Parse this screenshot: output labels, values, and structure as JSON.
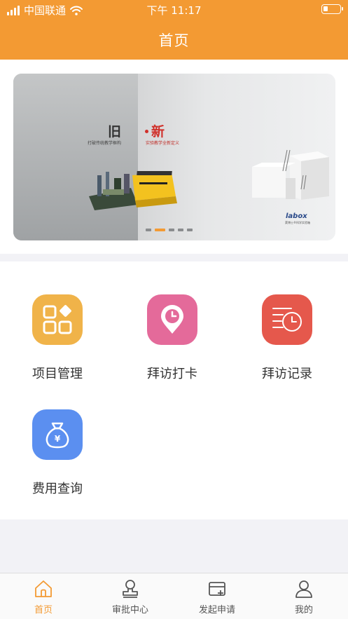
{
  "status_bar": {
    "carrier": "中国联通",
    "time": "下午 11:17"
  },
  "header": {
    "title": "首页"
  },
  "banner": {
    "old_title": "旧",
    "old_subtitle": "打破传统教学框构",
    "new_title": "新",
    "new_subtitle": "实验教学全新定义",
    "brand": "labox",
    "brand_subtitle": "萊博士®科学实验箱",
    "slide_count": 5,
    "active_slide": 2
  },
  "features": [
    {
      "label": "项目管理",
      "icon": "grid-apps-icon",
      "color": "#f0b349"
    },
    {
      "label": "拜访打卡",
      "icon": "location-clock-icon",
      "color": "#e46a9a"
    },
    {
      "label": "拜访记录",
      "icon": "clock-list-icon",
      "color": "#e5584c"
    },
    {
      "label": "费用查询",
      "icon": "money-bag-icon",
      "color": "#5b8ff0"
    }
  ],
  "tabbar": {
    "items": [
      {
        "label": "首页",
        "icon": "home-icon",
        "active": true
      },
      {
        "label": "审批中心",
        "icon": "stamp-icon",
        "active": false
      },
      {
        "label": "发起申请",
        "icon": "card-add-icon",
        "active": false
      },
      {
        "label": "我的",
        "icon": "user-icon",
        "active": false
      }
    ]
  },
  "colors": {
    "accent": "#f39a33",
    "background": "#f2f2f6"
  }
}
